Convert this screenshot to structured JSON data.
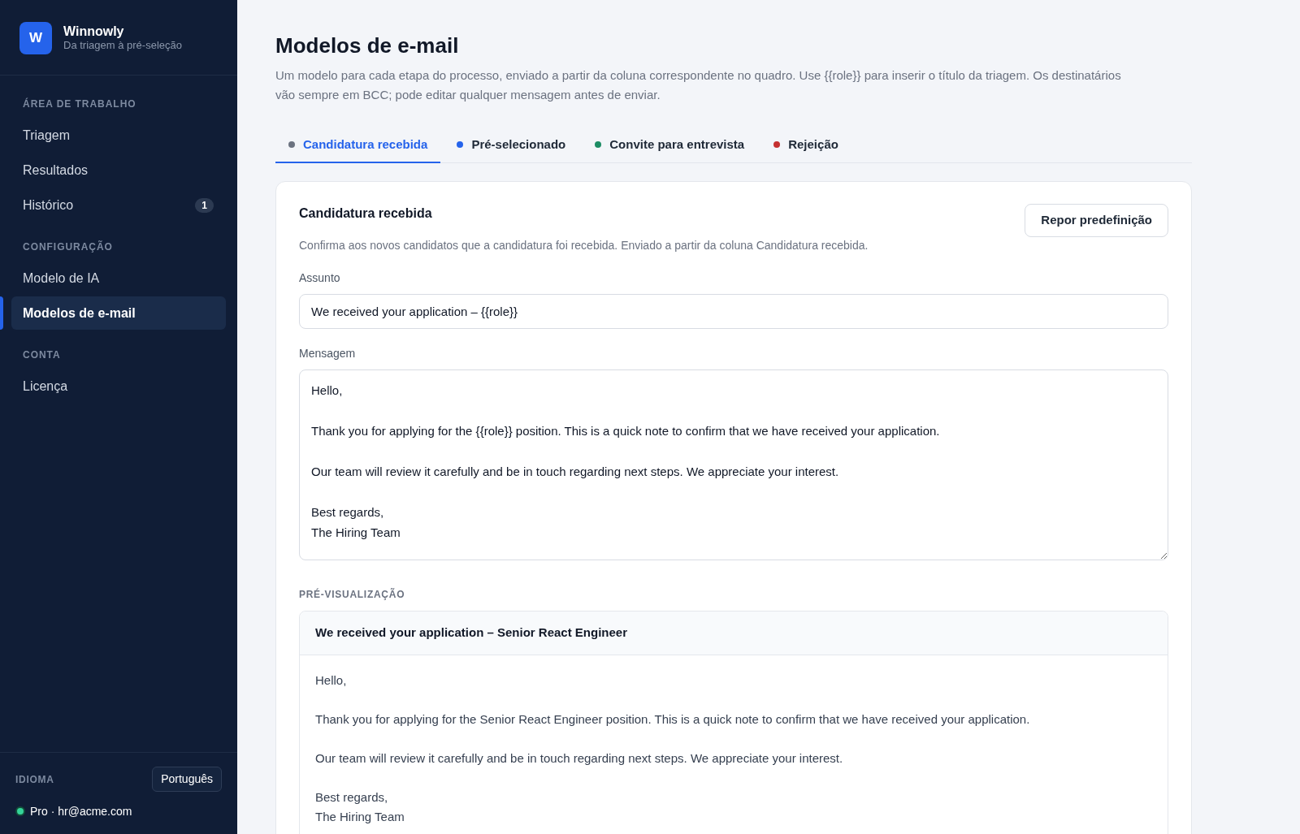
{
  "sidebar": {
    "brand": {
      "logo_letter": "W",
      "name": "Winnowly",
      "tagline": "Da triagem à pré-seleção"
    },
    "sections": [
      {
        "title": "ÁREA DE TRABALHO",
        "items": [
          {
            "label": "Triagem",
            "selected": false
          },
          {
            "label": "Resultados",
            "selected": false
          },
          {
            "label": "Histórico",
            "selected": false,
            "badge": "1"
          }
        ]
      },
      {
        "title": "CONFIGURAÇÃO",
        "items": [
          {
            "label": "Modelo de IA",
            "selected": false
          },
          {
            "label": "Modelos de e-mail",
            "selected": true
          }
        ]
      },
      {
        "title": "CONTA",
        "items": [
          {
            "label": "Licença",
            "selected": false
          }
        ]
      }
    ],
    "language": {
      "label": "IDIOMA",
      "value": "Português"
    },
    "account": {
      "text": "Pro · hr@acme.com"
    }
  },
  "page": {
    "title": "Modelos de e-mail",
    "description": "Um modelo para cada etapa do processo, enviado a partir da coluna correspondente no quadro. Use {{role}} para inserir o título da triagem. Os destinatários vão sempre em BCC; pode editar qualquer mensagem antes de enviar."
  },
  "tabs": [
    {
      "label": "Candidatura recebida",
      "color": "#6b7280",
      "selected": true
    },
    {
      "label": "Pré-selecionado",
      "color": "#2563eb",
      "selected": false
    },
    {
      "label": "Convite para entrevista",
      "color": "#1c8c64",
      "selected": false
    },
    {
      "label": "Rejeição",
      "color": "#c53030",
      "selected": false
    }
  ],
  "template": {
    "title": "Candidatura recebida",
    "reset_button": "Repor predefinição",
    "description": "Confirma aos novos candidatos que a candidatura foi recebida. Enviado a partir da coluna Candidatura recebida.",
    "subject": {
      "label": "Assunto",
      "value": "We received your application – {{role}}"
    },
    "message": {
      "label": "Mensagem",
      "value": "Hello,\n\nThank you for applying for the {{role}} position. This is a quick note to confirm that we have received your application.\n\nOur team will review it carefully and be in touch regarding next steps. We appreciate your interest.\n\nBest regards,\nThe Hiring Team"
    }
  },
  "preview": {
    "label": "PRÉ-VISUALIZAÇÃO",
    "subject": "We received your application – Senior React Engineer",
    "paragraphs": [
      "Hello,",
      "Thank you for applying for the Senior React Engineer position. This is a quick note to confirm that we have received your application.",
      "Our team will review it carefully and be in touch regarding next steps. We appreciate your interest.",
      "Best regards,\nThe Hiring Team"
    ]
  }
}
